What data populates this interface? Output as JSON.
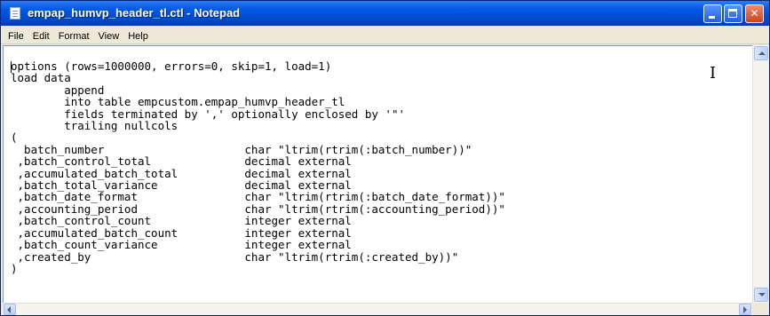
{
  "window": {
    "title": "empap_humvp_header_tl.ctl - Notepad",
    "icon": "notepad-icon",
    "controls": [
      "minimize-icon",
      "maximize-icon",
      "close-icon"
    ]
  },
  "menu": {
    "file": "File",
    "edit": "Edit",
    "format": "Format",
    "view": "View",
    "help": "Help"
  },
  "editor": {
    "content": "options (rows=1000000, errors=0, skip=1, load=1)\nload data\n        append\n        into table empcustom.empap_humvp_header_tl\n        fields terminated by ',' optionally enclosed by '\"'\n        trailing nullcols\n(\n  batch_number                     char \"ltrim(rtrim(:batch_number))\"\n ,batch_control_total              decimal external\n ,accumulated_batch_total          decimal external\n ,batch_total_variance             decimal external\n ,batch_date_format                char \"ltrim(rtrim(:batch_date_format))\"\n ,accounting_period                char \"ltrim(rtrim(:accounting_period))\"\n ,batch_control_count              integer external\n ,accumulated_batch_count          integer external\n ,batch_count_variance             integer external\n ,created_by                       char \"ltrim(rtrim(:created_by))\"\n)"
  },
  "colors": {
    "titlebar": "#0058e6",
    "close_button": "#c9431d",
    "menubar": "#ece9d8",
    "editor_bg": "#ffffff"
  }
}
